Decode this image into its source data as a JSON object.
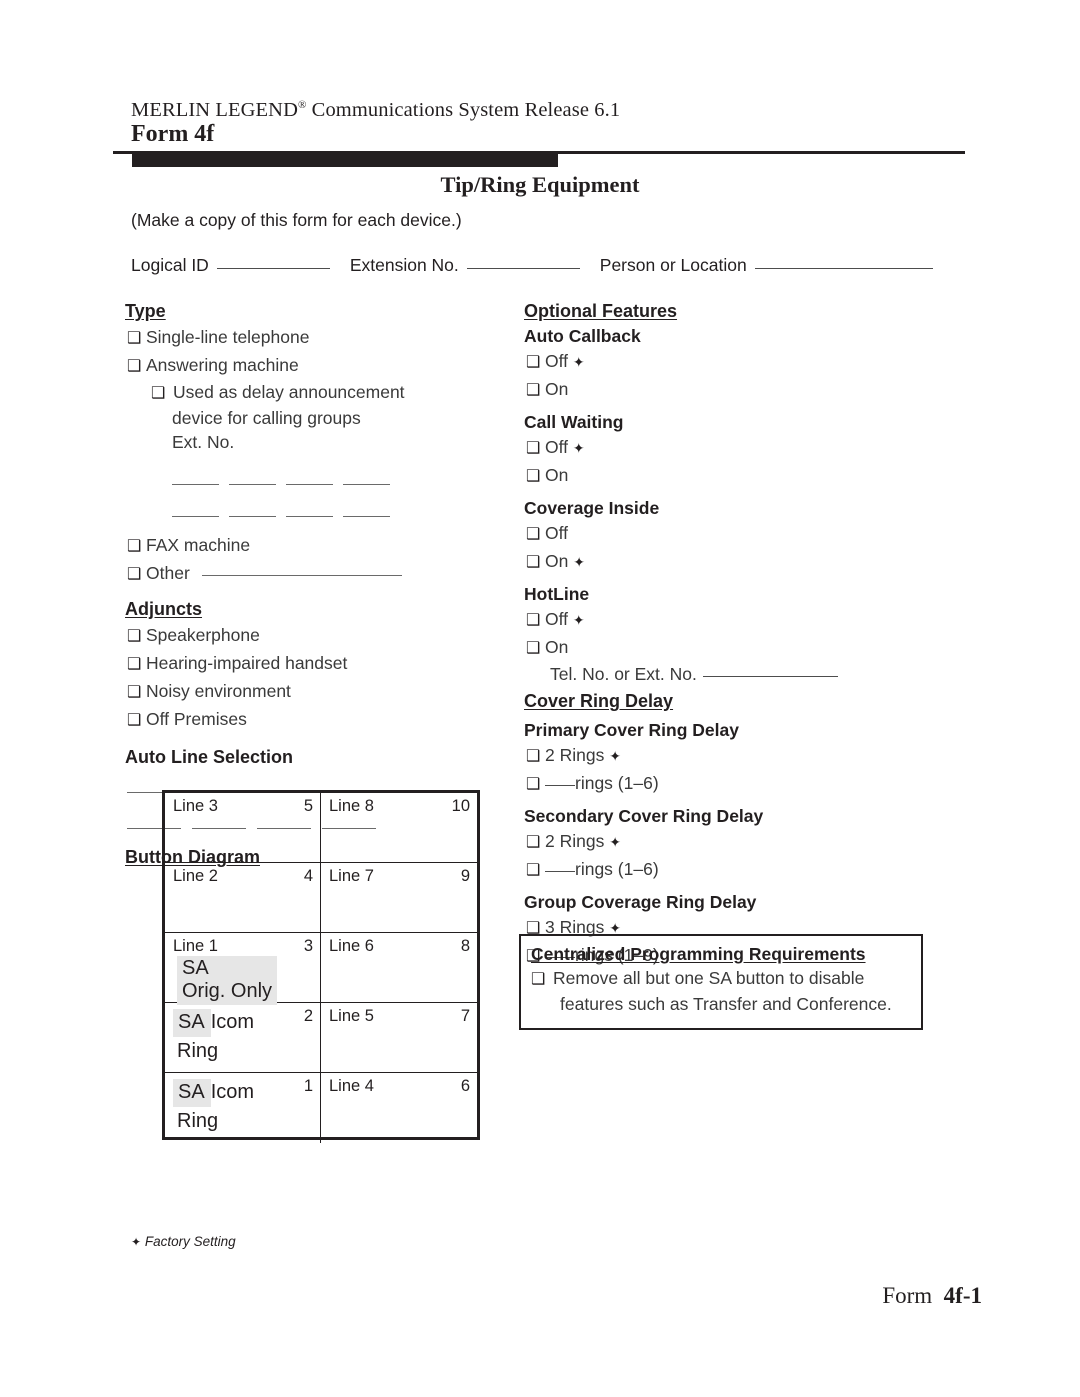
{
  "header": {
    "system_line": "MERLIN LEGEND",
    "system_line_sup": "®",
    "system_line_rest": " Communications System Release 6.1",
    "form_label": "Form 4f",
    "doc_title": "Tip/Ring Equipment",
    "instruction": "(Make a copy of this form for each device.)"
  },
  "id_line": {
    "logical_id_label": "Logical ID",
    "logical_id_value": "",
    "extension_label": "Extension No.",
    "extension_value": "",
    "person_label": "Person or Location",
    "person_value": ""
  },
  "left_column": {
    "type": {
      "heading": "Type",
      "items": [
        "Single-line telephone",
        "Answering machine"
      ],
      "nested_item": "Used as delay announcement",
      "nested_item_line2": "device for calling groups",
      "nested_item_line3": "Ext. No.",
      "items_after": [
        "FAX machine",
        "Other"
      ],
      "ext_no_blank_rows": 2,
      "ext_no_blanks_per_row": 4
    },
    "adjuncts": {
      "heading": "Adjuncts",
      "items": [
        "Speakerphone",
        "Hearing-impaired handset",
        "Noisy environment",
        "Off Premises"
      ]
    },
    "auto_line_selection": {
      "heading": "Auto Line Selection",
      "blank_rows": 2,
      "blanks_per_row": 4
    },
    "button_diagram": {
      "heading": "Button Diagram",
      "rows": [
        {
          "left": {
            "label": "Line 3",
            "number": "5",
            "special": null
          },
          "right": {
            "label": "Line 8",
            "number": "10",
            "special": null
          }
        },
        {
          "left": {
            "label": "Line 2",
            "number": "4",
            "special": null
          },
          "right": {
            "label": "Line 7",
            "number": "9",
            "special": null
          }
        },
        {
          "left": {
            "label": "Line 1",
            "number": "3",
            "special": "sa-orig",
            "sa_text": "SA",
            "sa_sub": "Orig. Only"
          },
          "right": {
            "label": "Line 6",
            "number": "8",
            "special": null
          }
        },
        {
          "left": {
            "label": "",
            "number": "2",
            "special": "sa-icom",
            "sa_text": "SA",
            "icom_text": "Icom",
            "ring_text": "Ring"
          },
          "right": {
            "label": "Line 5",
            "number": "7",
            "special": null
          }
        },
        {
          "left": {
            "label": "",
            "number": "1",
            "special": "sa-icom",
            "sa_text": "SA",
            "icom_text": "Icom",
            "ring_text": "Ring"
          },
          "right": {
            "label": "Line 4",
            "number": "6",
            "special": null
          }
        }
      ]
    }
  },
  "right_column": {
    "optional_features_heading": "Optional Features",
    "groups": [
      {
        "name": "Auto Callback",
        "options": [
          {
            "label": "Off",
            "factory": true
          },
          {
            "label": "On",
            "factory": false
          }
        ]
      },
      {
        "name": "Call Waiting",
        "options": [
          {
            "label": "Off",
            "factory": true
          },
          {
            "label": "On",
            "factory": false
          }
        ]
      },
      {
        "name": "Coverage Inside",
        "options": [
          {
            "label": "Off",
            "factory": false
          },
          {
            "label": "On",
            "factory": true
          }
        ]
      },
      {
        "name": "HotLine",
        "options": [
          {
            "label": "Off",
            "factory": true
          },
          {
            "label": "On",
            "factory": false
          }
        ],
        "sub_field_label": "Tel. No. or Ext. No.",
        "sub_field_value": ""
      }
    ],
    "cover_ring_delay_heading": "Cover Ring Delay",
    "ring_groups": [
      {
        "name": "Primary Cover Ring Delay",
        "default_option": "2 Rings",
        "default_factory": true,
        "custom_suffix": "rings (1–6)",
        "custom_value": ""
      },
      {
        "name": "Secondary Cover Ring Delay",
        "default_option": "2 Rings",
        "default_factory": true,
        "custom_suffix": "rings (1–6)",
        "custom_value": ""
      },
      {
        "name": "Group Coverage Ring Delay",
        "default_option": "3 Rings",
        "default_factory": true,
        "custom_suffix": "rings (1–9)",
        "custom_value": ""
      }
    ],
    "centralized_box": {
      "heading": "Centralized Programming Requirements",
      "item_line1": "Remove all but one SA button to disable",
      "item_line2": "features such as Transfer and Conference."
    }
  },
  "footer": {
    "factory_note": "Factory Setting",
    "form_word": "Form",
    "form_number": "4f-1"
  },
  "icons": {
    "checkbox": "❑",
    "factory_diamond": "✦"
  },
  "colors": {
    "ink": "#231f20",
    "body_text": "#3a3a3a",
    "rule": "#6a6a6a",
    "sa_shade": "#e6e6e6"
  }
}
